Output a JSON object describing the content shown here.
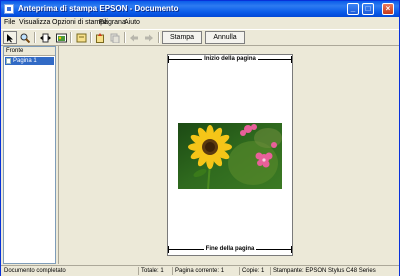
{
  "window": {
    "title": "Anteprima di stampa EPSON - Documento"
  },
  "menu": {
    "items": [
      "File",
      "Visualizza",
      "Opzioni di stampa",
      "Filigrana",
      "Aiuto"
    ]
  },
  "toolbar": {
    "icons": [
      "arrow-pointer-icon",
      "magnifier-icon",
      "fit-page-icon",
      "fit-image-icon",
      "page-icon",
      "add-page-icon",
      "copy-page-icon",
      "back-arrow-icon",
      "forward-arrow-icon"
    ],
    "print_label": "Stampa",
    "cancel_label": "Annulla"
  },
  "pages_panel": {
    "header": "Fronte",
    "items": [
      {
        "label": "Pagina 1",
        "selected": true
      }
    ]
  },
  "preview": {
    "top_marker": "Inizio della pagina",
    "bottom_marker": "Fine della pagina",
    "image_subject": "sunflower and pink flowers photo"
  },
  "status": {
    "message": "Documento completato",
    "total": "Totale: 1",
    "current_page": "Pagina corrente: 1",
    "copies": "Copie: 1",
    "printer": "Stampante: EPSON Stylus C48 Series"
  },
  "colors": {
    "titlebar": "#0a5ce9",
    "selection": "#316ac5",
    "face": "#ece9d8"
  }
}
